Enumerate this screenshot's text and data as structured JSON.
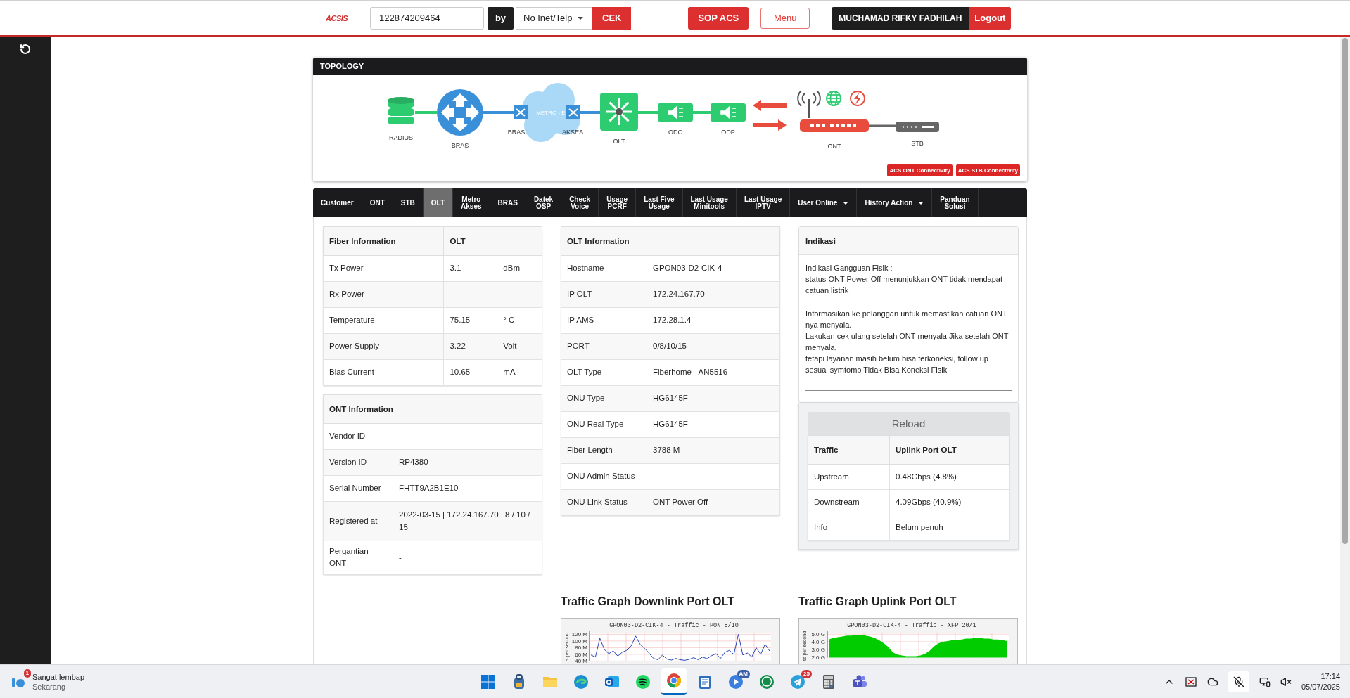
{
  "header": {
    "logo": "ACSIS",
    "search_value": "122874209464",
    "by_label": "by",
    "select_value": "No Inet/Telp",
    "check_button": "CEK",
    "sop_button": "SOP ACS",
    "menu_button": "Menu",
    "user_name": "MUCHAMAD RIFKY FADHILAH",
    "logout_button": "Logout"
  },
  "topology": {
    "title": "TOPOLOGY",
    "nodes": [
      {
        "kind": "database",
        "label": "RADIUS"
      },
      {
        "kind": "router",
        "label": "BRAS"
      },
      {
        "kind": "switch",
        "label": "BRAS"
      },
      {
        "kind": "cloud",
        "label": "METRO - E"
      },
      {
        "kind": "switch",
        "label": "AKSES"
      },
      {
        "kind": "olt",
        "label": "OLT"
      },
      {
        "kind": "splitter",
        "label": "ODC"
      },
      {
        "kind": "splitter",
        "label": "ODP"
      },
      {
        "kind": "ont",
        "label": "ONT"
      },
      {
        "kind": "stb",
        "label": "STB"
      }
    ],
    "buttons": [
      "ACS ONT Connectivity",
      "ACS STB Connectivity"
    ]
  },
  "tabs": [
    {
      "label": "Customer",
      "kind": "plain",
      "selected": false
    },
    {
      "label": "ONT",
      "kind": "plain",
      "selected": false
    },
    {
      "label": "STB",
      "kind": "plain",
      "selected": false
    },
    {
      "label": "OLT",
      "kind": "plain",
      "selected": true
    },
    {
      "label": "Metro\nAkses",
      "kind": "plain",
      "selected": false
    },
    {
      "label": "BRAS",
      "kind": "plain",
      "selected": false
    },
    {
      "label": "Datek\nOSP",
      "kind": "plain",
      "selected": false
    },
    {
      "label": "Check\nVoice",
      "kind": "plain",
      "selected": false
    },
    {
      "label": "Usage\nPCRF",
      "kind": "plain",
      "selected": false
    },
    {
      "label": "Last Five\nUsage",
      "kind": "plain",
      "selected": false
    },
    {
      "label": "Last Usage\nMinitools",
      "kind": "plain",
      "selected": false
    },
    {
      "label": "Last Usage\nIPTV",
      "kind": "plain",
      "selected": false
    },
    {
      "label": "User Online",
      "kind": "dropdown",
      "selected": false
    },
    {
      "label": "History Action",
      "kind": "dropdown",
      "selected": false
    },
    {
      "label": "Panduan\nSolusi",
      "kind": "plain",
      "selected": false
    }
  ],
  "fiber_information": {
    "header": {
      "parameter": "Fiber Information",
      "olt": "OLT"
    },
    "rows": [
      {
        "parameter": "Tx Power",
        "value": "3.1",
        "unit": "dBm"
      },
      {
        "parameter": "Rx Power",
        "value": "-",
        "unit": "-"
      },
      {
        "parameter": "Temperature",
        "value": "75.15",
        "unit": "° C"
      },
      {
        "parameter": "Power Supply",
        "value": "3.22",
        "unit": "Volt"
      },
      {
        "parameter": "Bias Current",
        "value": "10.65",
        "unit": "mA"
      }
    ]
  },
  "ont_information": {
    "title": "ONT Information",
    "rows": [
      [
        "Vendor ID",
        "-"
      ],
      [
        "Version ID",
        "RP4380"
      ],
      [
        "Serial Number",
        "FHTT9A2B1E10"
      ],
      [
        "Registered at",
        "2022-03-15 | 172.24.167.70 | 8 / 10 / 15"
      ],
      [
        "Pergantian ONT",
        "-"
      ]
    ]
  },
  "olt_information": {
    "title": "OLT Information",
    "rows": [
      [
        "Hostname",
        "GPON03-D2-CIK-4"
      ],
      [
        "IP OLT",
        "172.24.167.70"
      ],
      [
        "IP AMS",
        "172.28.1.4"
      ],
      [
        "PORT",
        "0/8/10/15"
      ],
      [
        "OLT Type",
        "Fiberhome - AN5516"
      ],
      [
        "ONU Type",
        "HG6145F"
      ],
      [
        "ONU Real Type",
        "HG6145F"
      ],
      [
        "Fiber Length",
        "3788 M"
      ],
      [
        "ONU Admin Status"
      ],
      [
        "ONU Link Status",
        "ONT Power Off"
      ]
    ]
  },
  "indikasi": {
    "title": "Indikasi",
    "paragraphs": [
      "Indikasi Gangguan Fisik :\nstatus ONT Power Off menunjukkan ONT tidak mendapat catuan listrik",
      "Informasikan ke pelanggan untuk memastikan catuan ONT nya menyala.\nLakukan cek ulang setelah ONT menyala.Jika setelah ONT menyala,\ntetapi layanan masih belum bisa terkoneksi, follow up sesuai symtomp Tidak Bisa Koneksi Fisik"
    ]
  },
  "traffic": {
    "reload_button": "Reload",
    "columns": [
      "Traffic",
      "Uplink Port OLT"
    ],
    "rows": [
      [
        "Upstream",
        "0.48Gbps (4.8%)"
      ],
      [
        "Downstream",
        "4.09Gbps (40.9%)"
      ],
      [
        "Info",
        "Belum penuh"
      ]
    ]
  },
  "graphs": [
    {
      "heading": "Traffic Graph Downlink Port OLT",
      "chart_data": {
        "type": "line",
        "title": "GPON03-D2-CIK-4 - Traffic - PON 8/10",
        "ylabel": "s per second",
        "grid": true,
        "ylim": [
          40,
          125
        ],
        "yticks": [
          {
            "value": 120,
            "label": "120 M"
          },
          {
            "value": 100,
            "label": "100 M"
          },
          {
            "value": 80,
            "label": "80 M"
          },
          {
            "value": 60,
            "label": "60 M"
          },
          {
            "value": 40,
            "label": "40 M"
          }
        ],
        "series": [
          {
            "color": "#2446b8",
            "values": [
              58,
              52,
              108,
              75,
              62,
              70,
              55,
              66,
              72,
              85,
              115,
              90,
              78,
              64,
              48,
              44,
              58,
              46,
              43,
              48,
              44,
              42,
              45,
              50,
              44,
              52,
              47,
              56,
              62,
              48,
              66,
              72,
              60,
              120,
              58,
              64,
              52,
              80,
              60,
              90,
              70
            ]
          }
        ]
      }
    },
    {
      "heading": "Traffic Graph Uplink Port OLT",
      "chart_data": {
        "type": "area",
        "title": "GPON03-D2-CIK-4 - Traffic - XFP 20/1",
        "ylabel": "ts per second",
        "grid": true,
        "ylim": [
          1.9,
          5.2
        ],
        "yticks": [
          {
            "value": 5,
            "label": "5.0 G"
          },
          {
            "value": 4,
            "label": "4.0 G"
          },
          {
            "value": 3,
            "label": "3.0 G"
          },
          {
            "value": 2,
            "label": "2.0 G"
          }
        ],
        "series": [
          {
            "color": "#00cc00",
            "values": [
              4.3,
              4.5,
              4.6,
              4.7,
              4.8,
              4.8,
              4.9,
              4.9,
              4.8,
              4.7,
              4.5,
              4.2,
              3.8,
              3.3,
              2.6,
              2.3,
              2.2,
              2.1,
              2.1,
              2.1,
              2.2,
              2.4,
              2.8,
              3.4,
              3.8,
              4.0,
              4.1,
              4.2,
              4.2,
              4.3,
              4.4,
              4.4,
              4.5,
              4.5,
              4.4,
              4.4,
              4.3,
              4.3,
              4.2,
              4.1
            ]
          }
        ]
      }
    }
  ],
  "taskbar": {
    "weather": {
      "badge": "1",
      "title": "Sangat lembap",
      "subtitle": "Sekarang"
    },
    "apps": [
      {
        "kind": "start",
        "selected": false
      },
      {
        "kind": "backpack",
        "selected": false
      },
      {
        "kind": "folder",
        "selected": false
      },
      {
        "kind": "edge",
        "selected": false
      },
      {
        "kind": "mail",
        "selected": false
      },
      {
        "kind": "music",
        "selected": false
      },
      {
        "kind": "chrome",
        "selected": true
      },
      {
        "kind": "notepad",
        "selected": false
      },
      {
        "kind": "video",
        "selected": false,
        "badge": "AM"
      },
      {
        "kind": "chat",
        "selected": false
      },
      {
        "kind": "send",
        "selected": false,
        "badge": "25"
      },
      {
        "kind": "calculator",
        "selected": false
      },
      {
        "kind": "teams",
        "selected": false
      }
    ],
    "time": "17:14",
    "date": "05/07/2025"
  }
}
